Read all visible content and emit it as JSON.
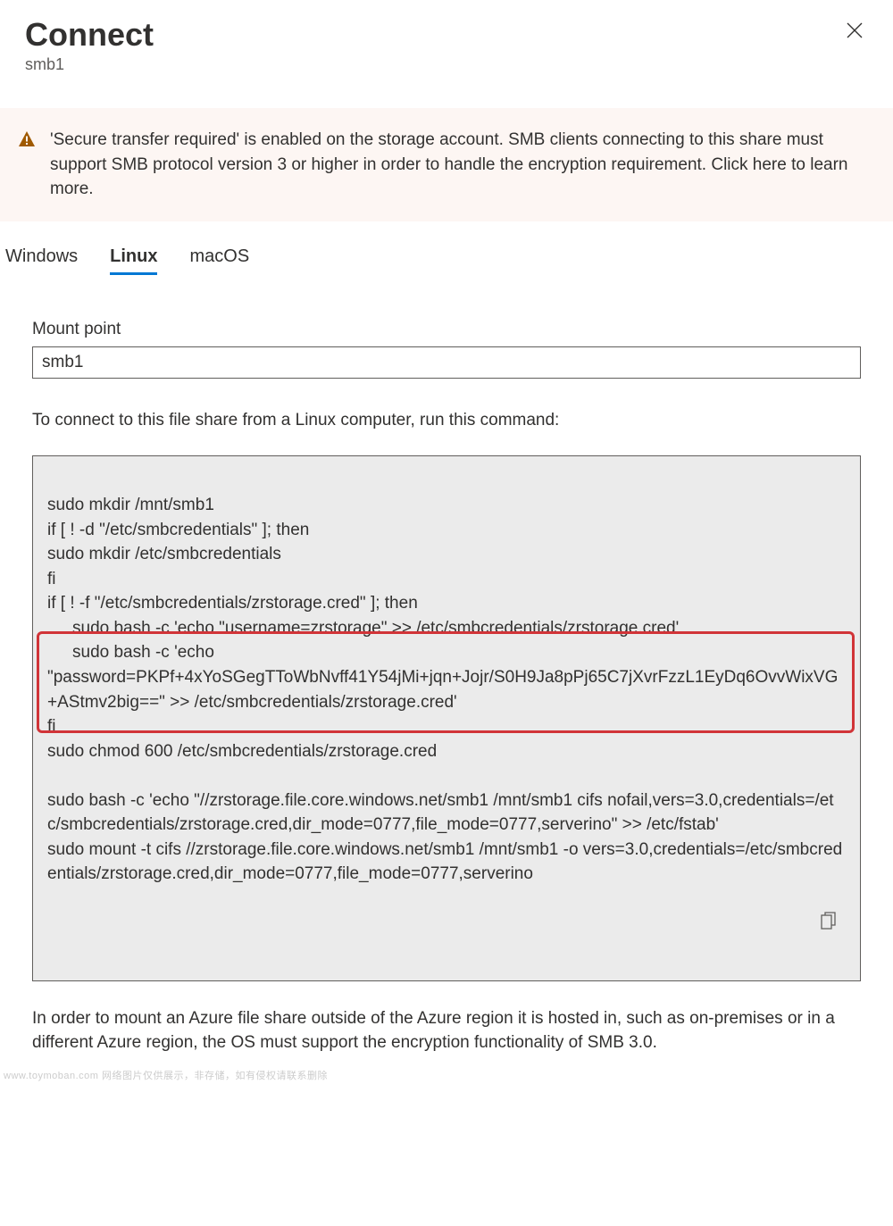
{
  "header": {
    "title": "Connect",
    "subtitle": "smb1"
  },
  "warning": {
    "text": "'Secure transfer required' is enabled on the storage account. SMB clients connecting to this share must support SMB protocol version 3 or higher in order to handle the encryption requirement. Click here to learn more."
  },
  "tabs": {
    "windows": "Windows",
    "linux": "Linux",
    "macos": "macOS",
    "active": "linux"
  },
  "form": {
    "mount_label": "Mount point",
    "mount_value": "smb1",
    "instruction": "To connect to this file share from a Linux computer, run this command:"
  },
  "code": {
    "l1": "sudo mkdir /mnt/smb1",
    "l2": "if [ ! -d \"/etc/smbcredentials\" ]; then",
    "l3": "sudo mkdir /etc/smbcredentials",
    "l4": "fi",
    "l5": "if [ ! -f \"/etc/smbcredentials/zrstorage.cred\" ]; then",
    "l6": "sudo bash -c 'echo \"username=zrstorage\" >> /etc/smbcredentials/zrstorage.cred'",
    "l7": "sudo bash -c 'echo",
    "l8": "\"password=PKPf+4xYoSGegTToWbNvff41Y54jMi+jqn+Jojr/S0H9Ja8pPj65C7jXvrFzzL1EyDq6OvvWixVG+AStmv2big==\" >> /etc/smbcredentials/zrstorage.cred'",
    "l9": "fi",
    "l10": "sudo chmod 600 /etc/smbcredentials/zrstorage.cred",
    "l11": "",
    "l12": "sudo bash -c 'echo \"//zrstorage.file.core.windows.net/smb1 /mnt/smb1 cifs nofail,vers=3.0,credentials=/etc/smbcredentials/zrstorage.cred,dir_mode=0777,file_mode=0777,serverino\" >> /etc/fstab'",
    "l13": "sudo mount -t cifs //zrstorage.file.core.windows.net/smb1 /mnt/smb1 -o vers=3.0,credentials=/etc/smbcredentials/zrstorage.cred,dir_mode=0777,file_mode=0777,serverino"
  },
  "footer": {
    "note": "In order to mount an Azure file share outside of the Azure region it is hosted in, such as on-premises or in a different Azure region, the OS must support the encryption functionality of SMB 3.0."
  },
  "watermark": "www.toymoban.com 网络图片仅供展示，非存储，如有侵权请联系删除"
}
